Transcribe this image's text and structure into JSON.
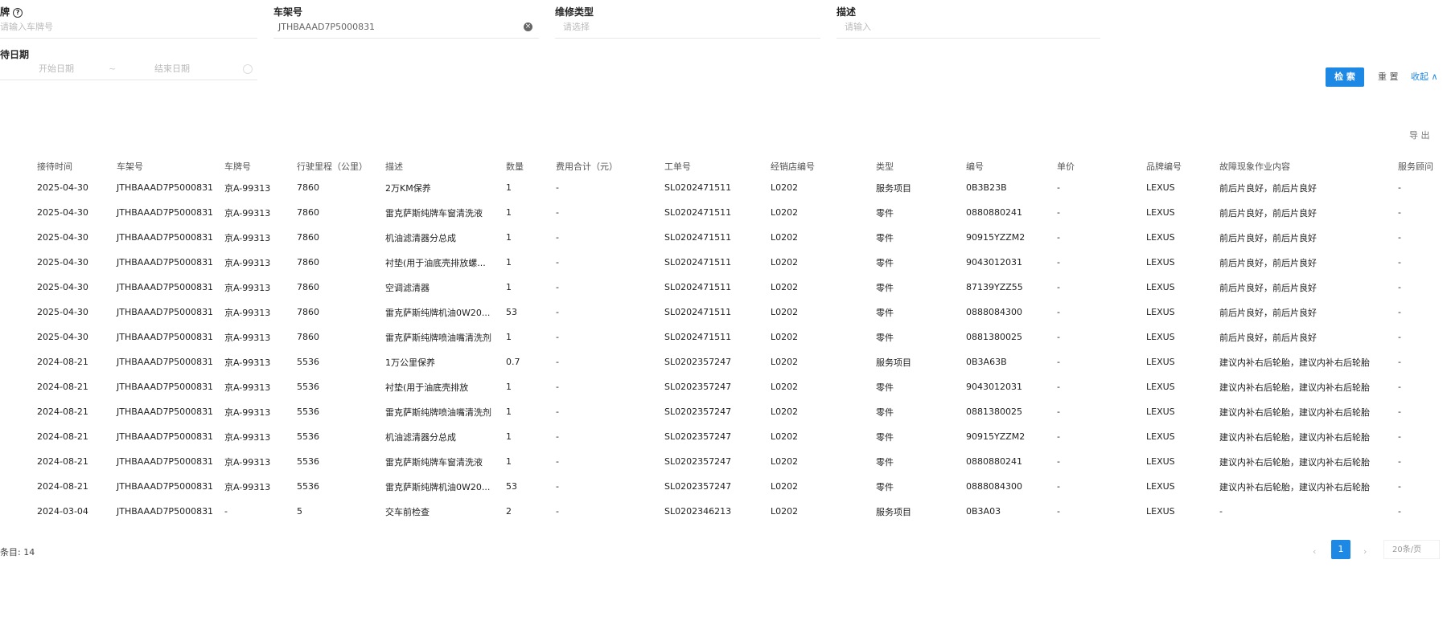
{
  "filters": {
    "plate": {
      "label": "牌",
      "help_icon": "?",
      "placeholder": "请输入车牌号"
    },
    "vin": {
      "label": "车架号",
      "value": "JTHBAAAD7P5000831"
    },
    "repair_type": {
      "label": "维修类型",
      "placeholder": "请选择"
    },
    "description": {
      "label": "描述",
      "placeholder": "请输入"
    },
    "date": {
      "label": "待日期",
      "start_placeholder": "开始日期",
      "separator": "~",
      "end_placeholder": "结束日期"
    }
  },
  "buttons": {
    "search": "检 索",
    "reset": "重 置",
    "collapse": "收起 ∧",
    "export": "导 出"
  },
  "table": {
    "headers": [
      "接待时间",
      "车架号",
      "车牌号",
      "行驶里程（公里）",
      "描述",
      "数量",
      "费用合计（元）",
      "工单号",
      "经销店编号",
      "类型",
      "编号",
      "单价",
      "品牌编号",
      "故障现象作业内容",
      "服务顾问"
    ],
    "rows": [
      {
        "date": "2025-04-30",
        "vin": "JTHBAAAD7P5000831",
        "plate": "京A-99313",
        "mileage": "7860",
        "desc": "2万KM保养",
        "qty": "1",
        "cost": "-",
        "order": "SL0202471511",
        "dealer": "L0202",
        "type": "服务项目",
        "code": "0B3B23B",
        "price": "-",
        "brand": "LEXUS",
        "content": "前后片良好，前后片良好",
        "advisor": "-"
      },
      {
        "date": "2025-04-30",
        "vin": "JTHBAAAD7P5000831",
        "plate": "京A-99313",
        "mileage": "7860",
        "desc": "雷克萨斯纯牌车窗清洗液",
        "qty": "1",
        "cost": "-",
        "order": "SL0202471511",
        "dealer": "L0202",
        "type": "零件",
        "code": "0880880241",
        "price": "-",
        "brand": "LEXUS",
        "content": "前后片良好，前后片良好",
        "advisor": "-"
      },
      {
        "date": "2025-04-30",
        "vin": "JTHBAAAD7P5000831",
        "plate": "京A-99313",
        "mileage": "7860",
        "desc": "机油滤清器分总成",
        "qty": "1",
        "cost": "-",
        "order": "SL0202471511",
        "dealer": "L0202",
        "type": "零件",
        "code": "90915YZZM2",
        "price": "-",
        "brand": "LEXUS",
        "content": "前后片良好，前后片良好",
        "advisor": "-"
      },
      {
        "date": "2025-04-30",
        "vin": "JTHBAAAD7P5000831",
        "plate": "京A-99313",
        "mileage": "7860",
        "desc": "衬垫(用于油底壳排放螺...",
        "qty": "1",
        "cost": "-",
        "order": "SL0202471511",
        "dealer": "L0202",
        "type": "零件",
        "code": "9043012031",
        "price": "-",
        "brand": "LEXUS",
        "content": "前后片良好，前后片良好",
        "advisor": "-"
      },
      {
        "date": "2025-04-30",
        "vin": "JTHBAAAD7P5000831",
        "plate": "京A-99313",
        "mileage": "7860",
        "desc": "空调滤清器",
        "qty": "1",
        "cost": "-",
        "order": "SL0202471511",
        "dealer": "L0202",
        "type": "零件",
        "code": "87139YZZ55",
        "price": "-",
        "brand": "LEXUS",
        "content": "前后片良好，前后片良好",
        "advisor": "-"
      },
      {
        "date": "2025-04-30",
        "vin": "JTHBAAAD7P5000831",
        "plate": "京A-99313",
        "mileage": "7860",
        "desc": "雷克萨斯纯牌机油0W20...",
        "qty": "53",
        "cost": "-",
        "order": "SL0202471511",
        "dealer": "L0202",
        "type": "零件",
        "code": "0888084300",
        "price": "-",
        "brand": "LEXUS",
        "content": "前后片良好，前后片良好",
        "advisor": "-"
      },
      {
        "date": "2025-04-30",
        "vin": "JTHBAAAD7P5000831",
        "plate": "京A-99313",
        "mileage": "7860",
        "desc": "雷克萨斯纯牌喷油嘴清洗剂",
        "qty": "1",
        "cost": "-",
        "order": "SL0202471511",
        "dealer": "L0202",
        "type": "零件",
        "code": "0881380025",
        "price": "-",
        "brand": "LEXUS",
        "content": "前后片良好，前后片良好",
        "advisor": "-"
      },
      {
        "date": "2024-08-21",
        "vin": "JTHBAAAD7P5000831",
        "plate": "京A-99313",
        "mileage": "5536",
        "desc": "1万公里保养",
        "qty": "0.7",
        "cost": "-",
        "order": "SL0202357247",
        "dealer": "L0202",
        "type": "服务项目",
        "code": "0B3A63B",
        "price": "-",
        "brand": "LEXUS",
        "content": "建议内补右后轮胎，建议内补右后轮胎",
        "advisor": "-"
      },
      {
        "date": "2024-08-21",
        "vin": "JTHBAAAD7P5000831",
        "plate": "京A-99313",
        "mileage": "5536",
        "desc": "衬垫(用于油底壳排放",
        "qty": "1",
        "cost": "-",
        "order": "SL0202357247",
        "dealer": "L0202",
        "type": "零件",
        "code": "9043012031",
        "price": "-",
        "brand": "LEXUS",
        "content": "建议内补右后轮胎，建议内补右后轮胎",
        "advisor": "-"
      },
      {
        "date": "2024-08-21",
        "vin": "JTHBAAAD7P5000831",
        "plate": "京A-99313",
        "mileage": "5536",
        "desc": "雷克萨斯纯牌喷油嘴清洗剂",
        "qty": "1",
        "cost": "-",
        "order": "SL0202357247",
        "dealer": "L0202",
        "type": "零件",
        "code": "0881380025",
        "price": "-",
        "brand": "LEXUS",
        "content": "建议内补右后轮胎，建议内补右后轮胎",
        "advisor": "-"
      },
      {
        "date": "2024-08-21",
        "vin": "JTHBAAAD7P5000831",
        "plate": "京A-99313",
        "mileage": "5536",
        "desc": "机油滤清器分总成",
        "qty": "1",
        "cost": "-",
        "order": "SL0202357247",
        "dealer": "L0202",
        "type": "零件",
        "code": "90915YZZM2",
        "price": "-",
        "brand": "LEXUS",
        "content": "建议内补右后轮胎，建议内补右后轮胎",
        "advisor": "-"
      },
      {
        "date": "2024-08-21",
        "vin": "JTHBAAAD7P5000831",
        "plate": "京A-99313",
        "mileage": "5536",
        "desc": "雷克萨斯纯牌车窗清洗液",
        "qty": "1",
        "cost": "-",
        "order": "SL0202357247",
        "dealer": "L0202",
        "type": "零件",
        "code": "0880880241",
        "price": "-",
        "brand": "LEXUS",
        "content": "建议内补右后轮胎，建议内补右后轮胎",
        "advisor": "-"
      },
      {
        "date": "2024-08-21",
        "vin": "JTHBAAAD7P5000831",
        "plate": "京A-99313",
        "mileage": "5536",
        "desc": "雷克萨斯纯牌机油0W20...",
        "qty": "53",
        "cost": "-",
        "order": "SL0202357247",
        "dealer": "L0202",
        "type": "零件",
        "code": "0888084300",
        "price": "-",
        "brand": "LEXUS",
        "content": "建议内补右后轮胎，建议内补右后轮胎",
        "advisor": "-"
      },
      {
        "date": "2024-03-04",
        "vin": "JTHBAAAD7P5000831",
        "plate": "-",
        "mileage": "5",
        "desc": "交车前检查",
        "qty": "2",
        "cost": "-",
        "order": "SL0202346213",
        "dealer": "L0202",
        "type": "服务项目",
        "code": "0B3A03",
        "price": "-",
        "brand": "LEXUS",
        "content": "-",
        "advisor": "-"
      }
    ]
  },
  "footer": {
    "count": "条目: 14",
    "prev": "‹",
    "current_page": "1",
    "next": "›",
    "page_size": "20条/页"
  },
  "colors": {
    "primary": "#1e88e5"
  }
}
